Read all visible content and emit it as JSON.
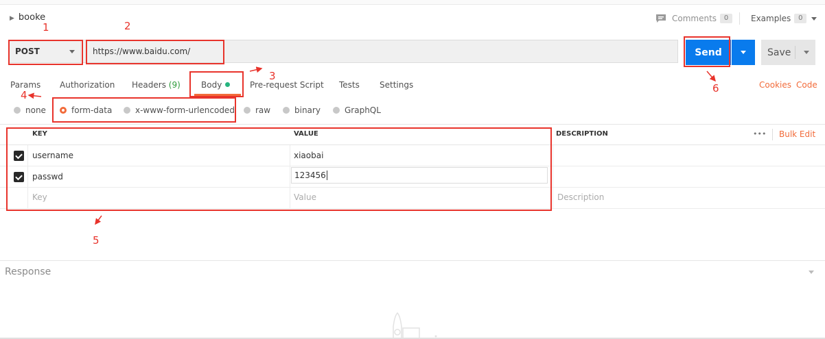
{
  "collection": {
    "name": "booke"
  },
  "topbar": {
    "comments_label": "Comments",
    "comments_count": "0",
    "examples_label": "Examples",
    "examples_count": "0"
  },
  "request": {
    "method": "POST",
    "url": "https://www.baidu.com/"
  },
  "actions": {
    "send": "Send",
    "save": "Save"
  },
  "tabs": [
    {
      "label": "Params"
    },
    {
      "label": "Authorization"
    },
    {
      "label": "Headers",
      "count": "(9)"
    },
    {
      "label": "Body"
    },
    {
      "label": "Pre-request Script"
    },
    {
      "label": "Tests"
    },
    {
      "label": "Settings"
    }
  ],
  "links": {
    "cookies": "Cookies",
    "code": "Code"
  },
  "body_types": [
    {
      "label": "none",
      "selected": false
    },
    {
      "label": "form-data",
      "selected": true
    },
    {
      "label": "x-www-form-urlencoded",
      "selected": false
    },
    {
      "label": "raw",
      "selected": false
    },
    {
      "label": "binary",
      "selected": false
    },
    {
      "label": "GraphQL",
      "selected": false
    }
  ],
  "table": {
    "headers": {
      "key": "KEY",
      "value": "VALUE",
      "description": "DESCRIPTION"
    },
    "more": "•••",
    "bulk_edit": "Bulk Edit",
    "rows": [
      {
        "key": "username",
        "value": "xiaobai",
        "checked": true
      },
      {
        "key": "passwd",
        "value": "123456",
        "checked": true
      }
    ],
    "placeholder": {
      "key": "Key",
      "value": "Value",
      "description": "Description"
    }
  },
  "annotations": {
    "n1": "1",
    "n2": "2",
    "n3": "3",
    "n4": "4",
    "n5": "5",
    "n6": "6"
  },
  "response": {
    "label": "Response"
  },
  "colors": {
    "accent": "#f26b3a",
    "send": "#097bed",
    "annotation": "#e8332b",
    "status_green": "#26b47f"
  }
}
